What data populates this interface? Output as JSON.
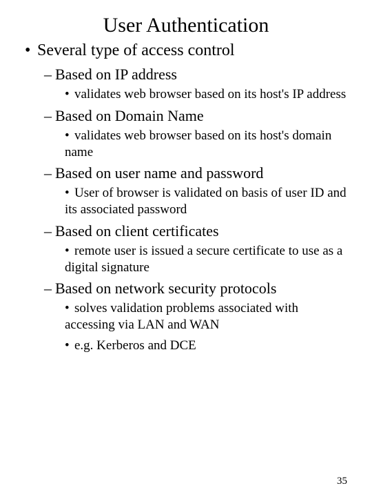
{
  "title": "User Authentication",
  "main_bullet": "Several type of  access control",
  "items": [
    {
      "heading": "Based on IP address",
      "subs": [
        "validates web browser based on its host's IP address"
      ]
    },
    {
      "heading": "Based on Domain Name",
      "subs": [
        "validates web browser based on its host's domain name"
      ]
    },
    {
      "heading": "Based on user name and password",
      "subs": [
        "User of browser is validated on basis of user ID and its associated password"
      ]
    },
    {
      "heading": "Based on client certificates",
      "subs": [
        "remote user is issued a secure certificate to use as a digital signature"
      ]
    },
    {
      "heading": "Based on network security protocols",
      "subs": [
        "solves validation problems associated with accessing via LAN and WAN",
        "e.g. Kerberos and DCE"
      ]
    }
  ],
  "page_number": "35"
}
